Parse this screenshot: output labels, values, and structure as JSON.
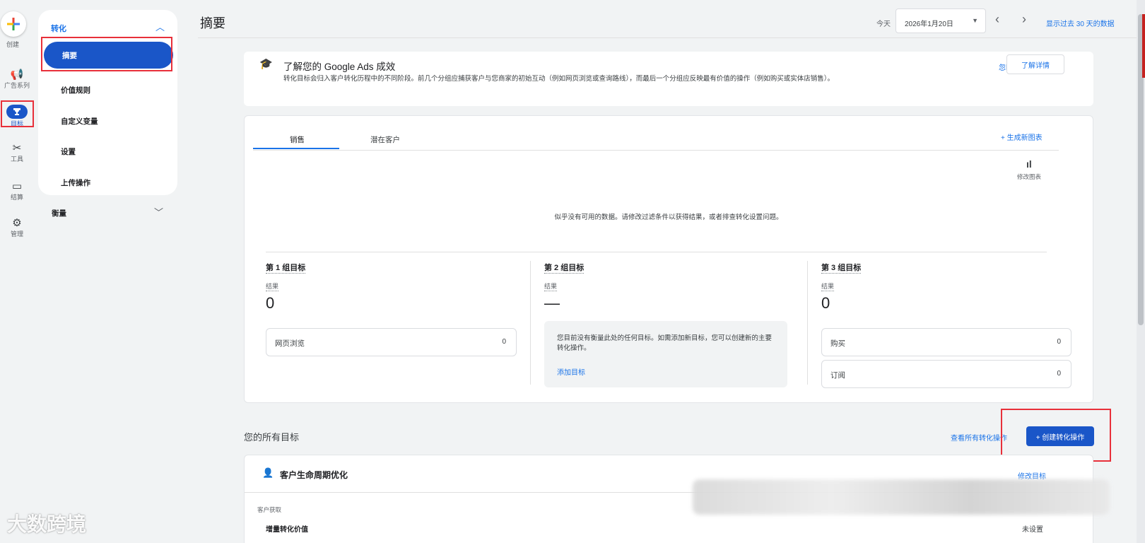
{
  "rail": {
    "create": "创建",
    "campaigns": "广告系列",
    "goals": "目标",
    "tools": "工具",
    "billing": "结算",
    "admin": "管理"
  },
  "subnav": {
    "section": "转化",
    "items": [
      "摘要",
      "价值规则",
      "自定义变量",
      "设置",
      "上传操作"
    ],
    "measure": "衡量"
  },
  "header": {
    "title": "摘要",
    "today_label": "今天",
    "date": "2026年1月20日",
    "show_range": "显示过去 30 天的数据"
  },
  "banner": {
    "title": "了解您的 Google Ads 成效",
    "description": "转化目标会归入客户转化历程中的不同阶段。前几个分组应捕获客户与您商家的初始互动（例如网页浏览或查询路线），而最后一个分组应反映最有价值的操作（例如购买或实体店销售）。",
    "dismiss": "忽略",
    "learn_more": "了解详情"
  },
  "summary": {
    "tabs": [
      "销售",
      "潜在客户"
    ],
    "generate_chart": "+ 生成新图表",
    "edit_chart": "修改图表",
    "no_data": "似乎没有可用的数据。请修改过滤条件以获得结果，或者排查转化设置问题。",
    "stages": [
      {
        "title": "第 1 组目标",
        "sub": "结果",
        "value": "0",
        "rows": [
          {
            "label": "网页浏览",
            "value": "0"
          }
        ]
      },
      {
        "title": "第 2 组目标",
        "sub": "结果",
        "value": "—",
        "empty_msg": "您目前没有衡量此处的任何目标。如需添加新目标，您可以创建新的主要转化操作。",
        "add": "添加目标"
      },
      {
        "title": "第 3 组目标",
        "sub": "结果",
        "value": "0",
        "rows": [
          {
            "label": "购买",
            "value": "0"
          },
          {
            "label": "订阅",
            "value": "0"
          }
        ]
      }
    ]
  },
  "goals": {
    "title": "您的所有目标",
    "view_all": "查看所有转化操作",
    "create": "+ 创建转化操作"
  },
  "lifecycle": {
    "title": "客户生命周期优化",
    "edit": "修改目标",
    "category": "客户获取",
    "item": "增量转化价值",
    "status": "未设置"
  },
  "watermark": "大数跨境",
  "colors": {
    "accent": "#1a73e8",
    "primary": "#1a56c8",
    "highlight": "#e8303a"
  }
}
